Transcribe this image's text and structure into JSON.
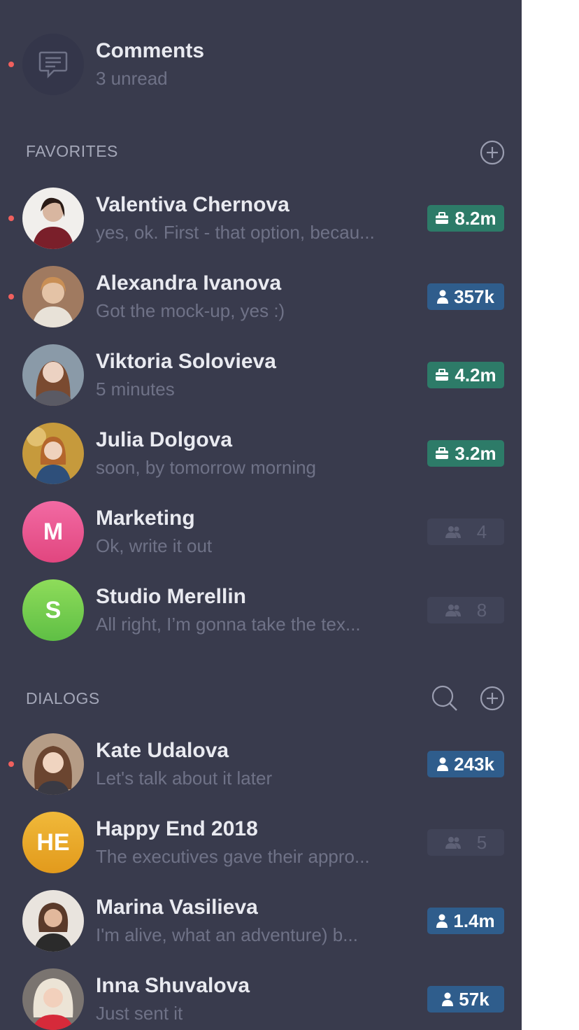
{
  "comments": {
    "title": "Comments",
    "subtitle": "3 unread"
  },
  "favorites": {
    "label": "FAVORITES",
    "items": [
      {
        "name": "Valentiva Chernova",
        "message": "yes, ok. First - that option, becau...",
        "badge": "8.2m"
      },
      {
        "name": "Alexandra Ivanova",
        "message": "Got the mock-up, yes :)",
        "badge": "357k"
      },
      {
        "name": "Viktoria Solovieva",
        "message": "5 minutes",
        "badge": "4.2m"
      },
      {
        "name": "Julia Dolgova",
        "message": "soon, by tomorrow morning",
        "badge": "3.2m"
      },
      {
        "name": "Marketing",
        "initials": "M",
        "message": "Ok, write it out",
        "badge": "4"
      },
      {
        "name": "Studio Merellin",
        "initials": "S",
        "message": "All right, I’m gonna take the tex...",
        "badge": "8"
      }
    ]
  },
  "dialogs": {
    "label": "DIALOGS",
    "items": [
      {
        "name": "Kate Udalova",
        "message": "Let's talk about it later",
        "badge": "243k"
      },
      {
        "name": "Happy End 2018",
        "initials": "HE",
        "message": "The executives gave their appro...",
        "badge": "5"
      },
      {
        "name": "Marina Vasilieva",
        "message": "I'm alive, what an adventure) b...",
        "badge": "1.4m"
      },
      {
        "name": "Inna Shuvalova",
        "message": "Just sent it",
        "badge": "57k"
      }
    ]
  },
  "colors": {
    "sidebar_bg": "#393b4d",
    "unread_dot": "#f0605e",
    "badge_green": "#2d7b68",
    "badge_blue": "#2f5d8c",
    "badge_muted": "#404357"
  }
}
